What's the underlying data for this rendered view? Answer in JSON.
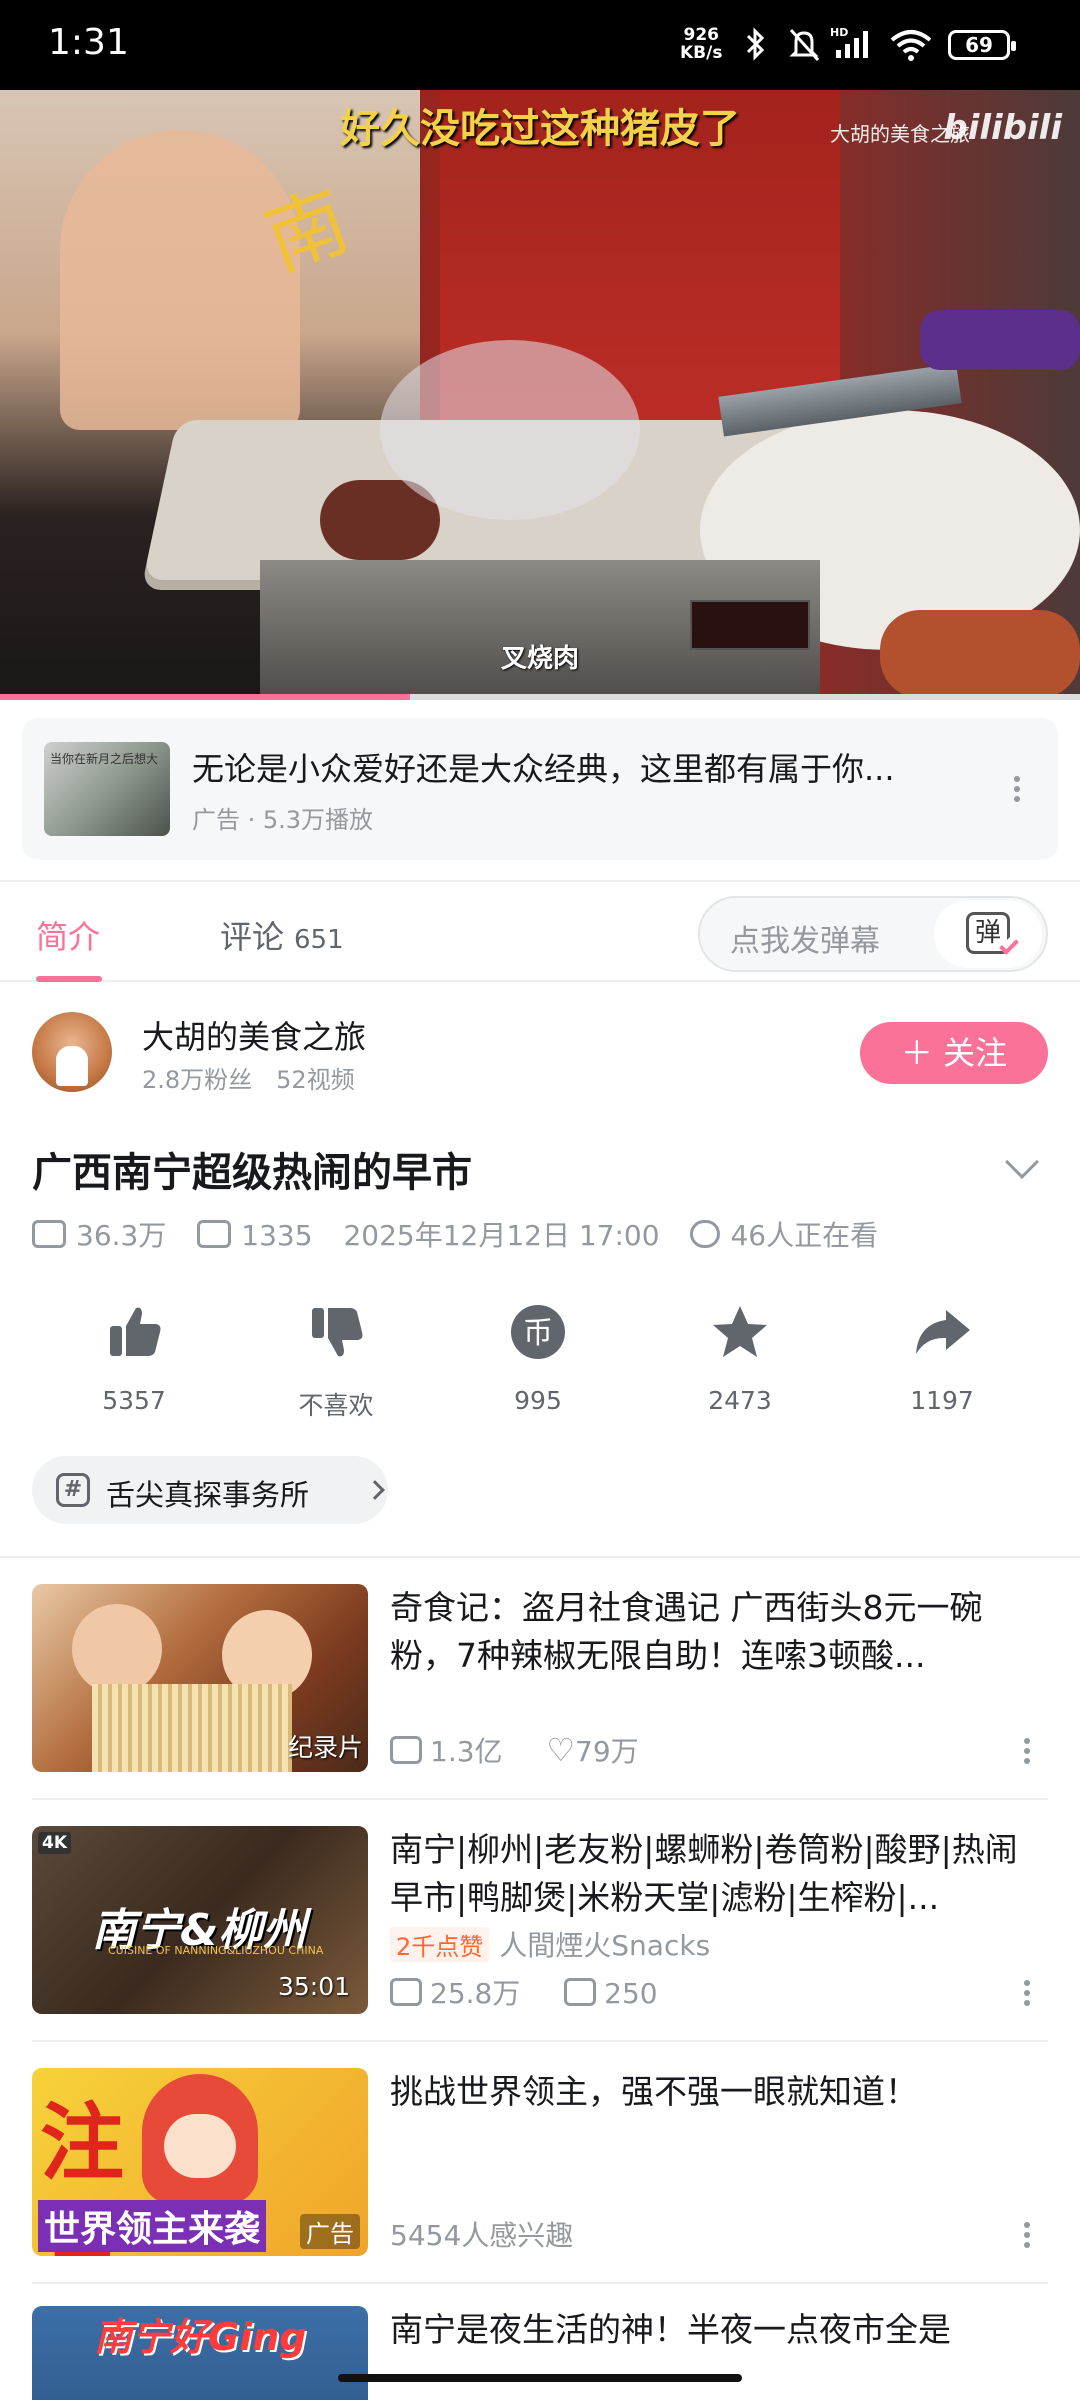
{
  "status_bar": {
    "time": "1:31",
    "net_speed_value": "926",
    "net_speed_unit": "KB/s",
    "battery": "69",
    "icons": [
      "bluetooth-icon",
      "mute-icon",
      "hd-signal-icon",
      "wifi-icon",
      "battery-icon"
    ]
  },
  "video": {
    "subtitle_top": "好久没吃过这种猪皮了",
    "watermark": "大胡的美食之旅",
    "logo": "bilibili",
    "subtitle_bottom": "叉烧肉",
    "progress_fraction": 0.38
  },
  "ad_card": {
    "thumb_text": "当你在新月之后想大",
    "title": "无论是小众爱好还是大众经典，这里都有属于你...",
    "meta": "广告 · 5.3万播放"
  },
  "tabs": {
    "intro": "简介",
    "comments": "评论",
    "comments_count": "651",
    "danmaku_placeholder": "点我发弹幕",
    "danmaku_icon_text": "弹"
  },
  "uploader": {
    "name": "大胡的美食之旅",
    "stats": "2.8万粉丝　52视频",
    "follow_label": "＋ 关注"
  },
  "video_info": {
    "title": "广西南宁超级热闹的早市",
    "views": "36.3万",
    "danmaku_count": "1335",
    "date": "2025年12月12日 17:00",
    "watching": "46人正在看"
  },
  "actions": [
    {
      "label": "5357",
      "icon": "like-icon"
    },
    {
      "label": "不喜欢",
      "icon": "dislike-icon"
    },
    {
      "label": "995",
      "icon": "coin-icon",
      "glyph": "币"
    },
    {
      "label": "2473",
      "icon": "favorite-icon"
    },
    {
      "label": "1197",
      "icon": "share-icon"
    }
  ],
  "tag_chip": {
    "label": "舌尖真探事务所",
    "icon_glyph": "#"
  },
  "recommendations": [
    {
      "title": "奇食记：盗月社食遇记 广西街头8元一碗粉，7种辣椒无限自助！连嗦3顿酸...",
      "badge": "纪录片",
      "views": "1.3亿",
      "likes": "79万"
    },
    {
      "title": "南宁|柳州|老友粉|螺蛳粉|卷筒粉|酸野|热闹早市|鸭脚煲|米粉天堂|滤粉|生榨粉|...",
      "duration": "35:01",
      "thumb_text": "南宁&柳州",
      "thumb_subtext": "CUISINE OF NANNING&LIUZHOU CHINA",
      "thumb_corner": "4K",
      "tag": "2千点赞",
      "author": "人間煙火Snacks",
      "views": "25.8万",
      "danmaku": "250"
    },
    {
      "title": "挑战世界领主，强不强一眼就知道！",
      "badge": "广告",
      "thumb_text": "注意",
      "thumb_subtext": "世界领主来袭",
      "interest": "5454人感兴趣"
    },
    {
      "title": "南宁是夜生活的神！半夜一点夜市全是",
      "thumb_text": "南宁好Ging"
    }
  ],
  "colors": {
    "accent": "#fb7299",
    "text_primary": "#18191c",
    "text_secondary": "#9499a0",
    "subtitle_yellow": "#f3d24a"
  }
}
